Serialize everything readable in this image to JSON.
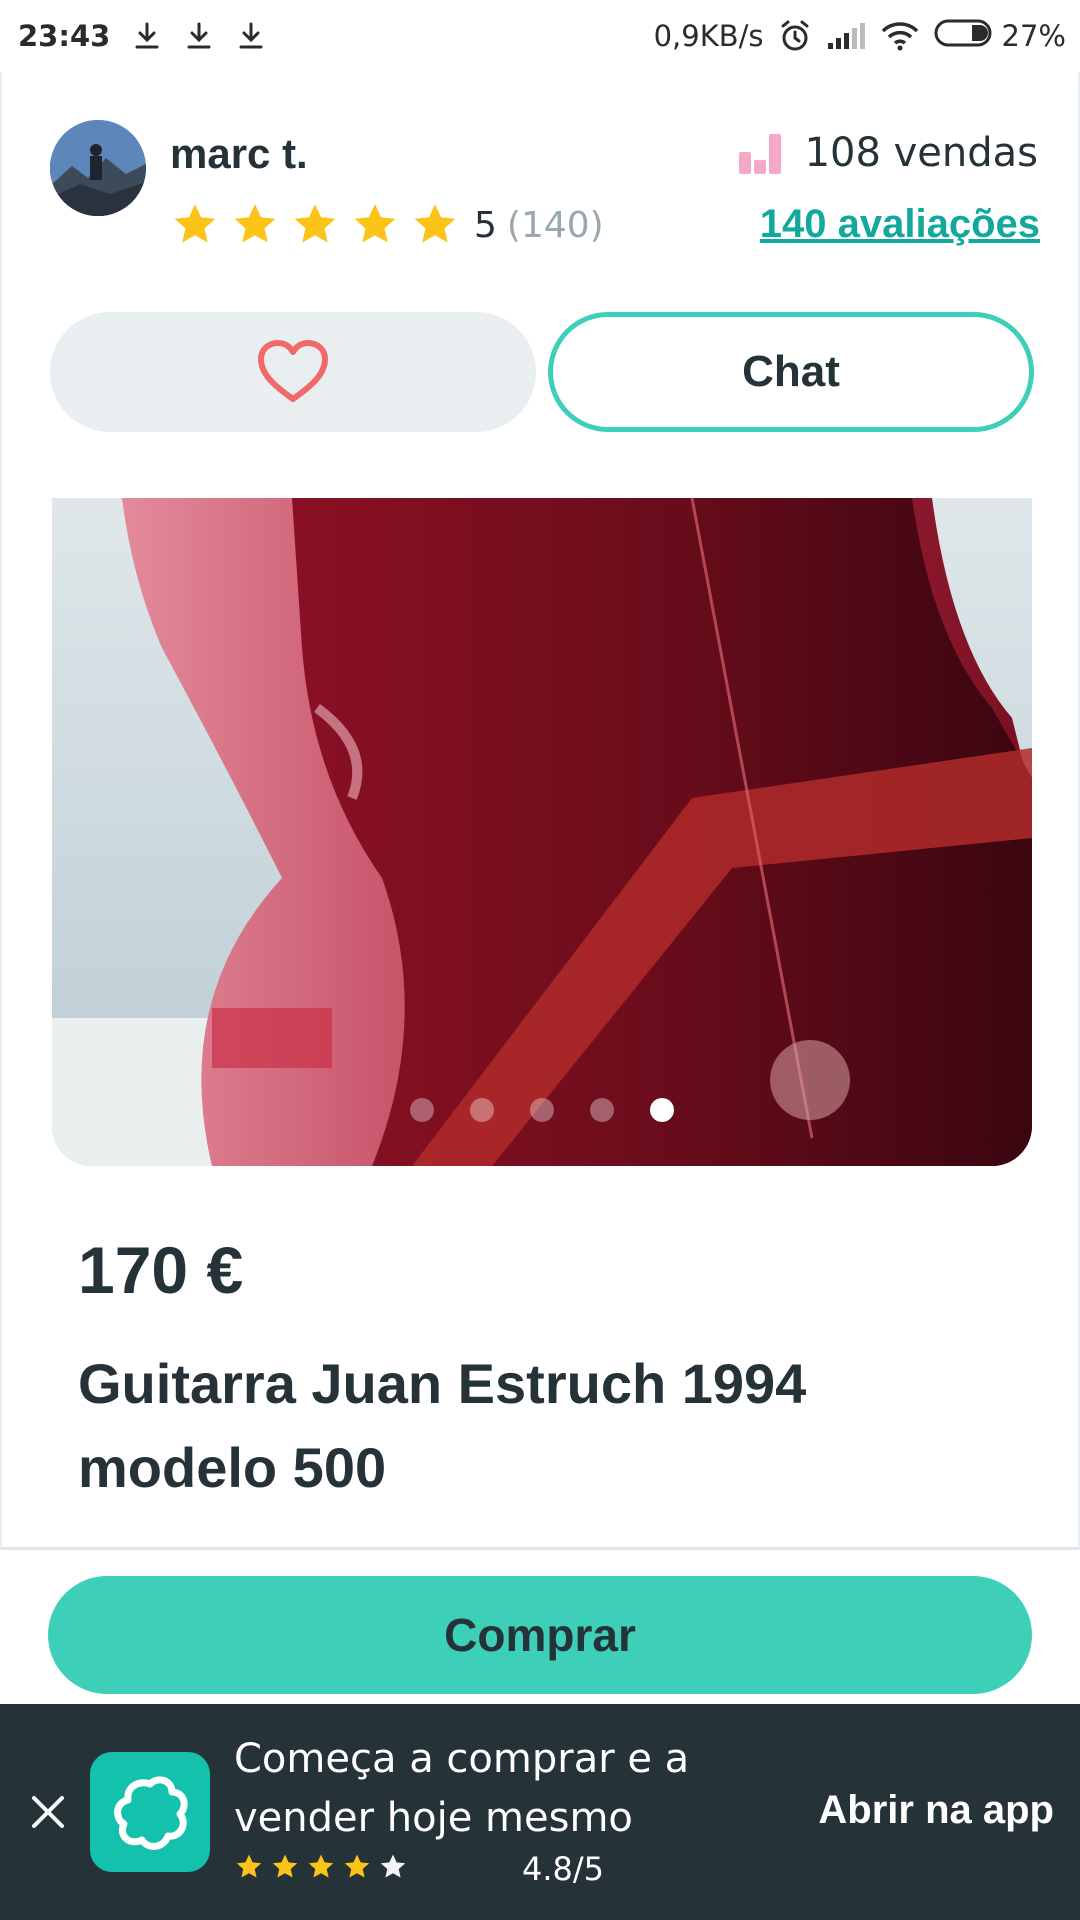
{
  "status_bar": {
    "time": "23:43",
    "network_speed": "0,9KB/s",
    "battery": "27%",
    "icons": [
      "download-icon",
      "download-icon",
      "download-icon",
      "alarm-icon",
      "signal-icon",
      "wifi-icon",
      "battery-icon"
    ]
  },
  "seller": {
    "name": "marc t.",
    "rating_value": "5",
    "rating_count": "(140)",
    "stars": 5,
    "sales": "108 vendas",
    "reviews_link": "140 avaliações"
  },
  "actions": {
    "favorite_icon": "heart-icon",
    "chat_label": "Chat"
  },
  "gallery": {
    "image_count": 5,
    "active_index": 4
  },
  "item": {
    "price": "170 €",
    "title": "Guitarra Juan Estruch 1994 modelo 500"
  },
  "buy_label": "Comprar",
  "app_banner": {
    "message": "Começa a comprar e a vender hoje mesmo",
    "stars_full": 4,
    "rating": "4.8/5",
    "open_label": "Abrir na app"
  },
  "colors": {
    "accent": "#3dcfb7",
    "link": "#13a89e",
    "text": "#253238",
    "star": "#fcc419",
    "heart": "#f06a6a",
    "banner_bg": "#253238"
  }
}
